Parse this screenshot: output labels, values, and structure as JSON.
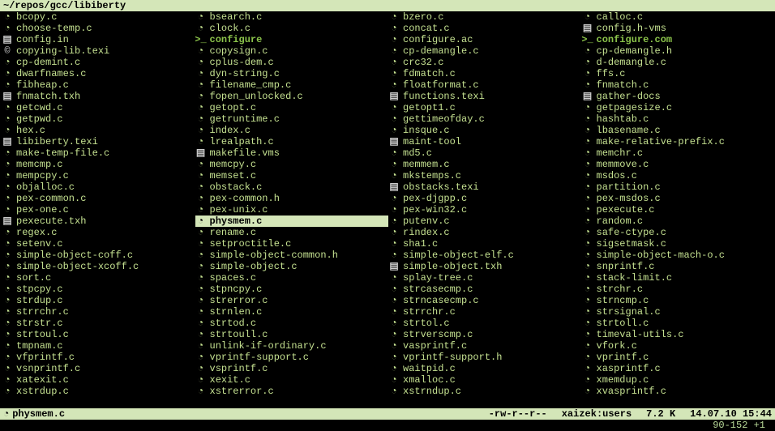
{
  "header": {
    "path": "~/repos/gcc/libiberty"
  },
  "columns": 4,
  "rows": 35,
  "files": [
    {
      "icon": "c",
      "name": "bcopy.c"
    },
    {
      "icon": "c",
      "name": "choose-temp.c"
    },
    {
      "icon": "t",
      "name": "config.in"
    },
    {
      "icon": "o",
      "name": "copying-lib.texi"
    },
    {
      "icon": "c",
      "name": "cp-demint.c"
    },
    {
      "icon": "c",
      "name": "dwarfnames.c"
    },
    {
      "icon": "c",
      "name": "fibheap.c"
    },
    {
      "icon": "t",
      "name": "fnmatch.txh"
    },
    {
      "icon": "c",
      "name": "getcwd.c"
    },
    {
      "icon": "c",
      "name": "getpwd.c"
    },
    {
      "icon": "c",
      "name": "hex.c"
    },
    {
      "icon": "t",
      "name": "libiberty.texi"
    },
    {
      "icon": "c",
      "name": "make-temp-file.c"
    },
    {
      "icon": "c",
      "name": "memcmp.c"
    },
    {
      "icon": "c",
      "name": "mempcpy.c"
    },
    {
      "icon": "c",
      "name": "objalloc.c"
    },
    {
      "icon": "c",
      "name": "pex-common.c"
    },
    {
      "icon": "c",
      "name": "pex-one.c"
    },
    {
      "icon": "t",
      "name": "pexecute.txh"
    },
    {
      "icon": "c",
      "name": "regex.c"
    },
    {
      "icon": "c",
      "name": "setenv.c"
    },
    {
      "icon": "c",
      "name": "simple-object-coff.c"
    },
    {
      "icon": "c",
      "name": "simple-object-xcoff.c"
    },
    {
      "icon": "c",
      "name": "sort.c"
    },
    {
      "icon": "c",
      "name": "stpcpy.c"
    },
    {
      "icon": "c",
      "name": "strdup.c"
    },
    {
      "icon": "c",
      "name": "strrchr.c"
    },
    {
      "icon": "c",
      "name": "strstr.c"
    },
    {
      "icon": "c",
      "name": "strtoul.c"
    },
    {
      "icon": "c",
      "name": "tmpnam.c"
    },
    {
      "icon": "c",
      "name": "vfprintf.c"
    },
    {
      "icon": "c",
      "name": "vsnprintf.c"
    },
    {
      "icon": "c",
      "name": "xatexit.c"
    },
    {
      "icon": "c",
      "name": "xstrdup.c"
    },
    {
      "icon": "",
      "name": ""
    },
    {
      "icon": "c",
      "name": "bsearch.c"
    },
    {
      "icon": "c",
      "name": "clock.c"
    },
    {
      "icon": "x",
      "name": "configure",
      "exec": true
    },
    {
      "icon": "c",
      "name": "copysign.c"
    },
    {
      "icon": "c",
      "name": "cplus-dem.c"
    },
    {
      "icon": "c",
      "name": "dyn-string.c"
    },
    {
      "icon": "c",
      "name": "filename_cmp.c"
    },
    {
      "icon": "c",
      "name": "fopen_unlocked.c"
    },
    {
      "icon": "c",
      "name": "getopt.c"
    },
    {
      "icon": "c",
      "name": "getruntime.c"
    },
    {
      "icon": "c",
      "name": "index.c"
    },
    {
      "icon": "c",
      "name": "lrealpath.c"
    },
    {
      "icon": "t",
      "name": "makefile.vms"
    },
    {
      "icon": "c",
      "name": "memcpy.c"
    },
    {
      "icon": "c",
      "name": "memset.c"
    },
    {
      "icon": "c",
      "name": "obstack.c"
    },
    {
      "icon": "c",
      "name": "pex-common.h"
    },
    {
      "icon": "c",
      "name": "pex-unix.c"
    },
    {
      "icon": "c",
      "name": "physmem.c",
      "selected": true
    },
    {
      "icon": "c",
      "name": "rename.c"
    },
    {
      "icon": "c",
      "name": "setproctitle.c"
    },
    {
      "icon": "c",
      "name": "simple-object-common.h"
    },
    {
      "icon": "c",
      "name": "simple-object.c"
    },
    {
      "icon": "c",
      "name": "spaces.c"
    },
    {
      "icon": "c",
      "name": "stpncpy.c"
    },
    {
      "icon": "c",
      "name": "strerror.c"
    },
    {
      "icon": "c",
      "name": "strnlen.c"
    },
    {
      "icon": "c",
      "name": "strtod.c"
    },
    {
      "icon": "c",
      "name": "strtoull.c"
    },
    {
      "icon": "c",
      "name": "unlink-if-ordinary.c"
    },
    {
      "icon": "c",
      "name": "vprintf-support.c"
    },
    {
      "icon": "c",
      "name": "vsprintf.c"
    },
    {
      "icon": "c",
      "name": "xexit.c"
    },
    {
      "icon": "c",
      "name": "xstrerror.c"
    },
    {
      "icon": "",
      "name": ""
    },
    {
      "icon": "c",
      "name": "bzero.c"
    },
    {
      "icon": "c",
      "name": "concat.c"
    },
    {
      "icon": "c",
      "name": "configure.ac"
    },
    {
      "icon": "c",
      "name": "cp-demangle.c"
    },
    {
      "icon": "c",
      "name": "crc32.c"
    },
    {
      "icon": "c",
      "name": "fdmatch.c"
    },
    {
      "icon": "c",
      "name": "floatformat.c"
    },
    {
      "icon": "t",
      "name": "functions.texi"
    },
    {
      "icon": "c",
      "name": "getopt1.c"
    },
    {
      "icon": "c",
      "name": "gettimeofday.c"
    },
    {
      "icon": "c",
      "name": "insque.c"
    },
    {
      "icon": "t",
      "name": "maint-tool"
    },
    {
      "icon": "c",
      "name": "md5.c"
    },
    {
      "icon": "c",
      "name": "memmem.c"
    },
    {
      "icon": "c",
      "name": "mkstemps.c"
    },
    {
      "icon": "t",
      "name": "obstacks.texi"
    },
    {
      "icon": "c",
      "name": "pex-djgpp.c"
    },
    {
      "icon": "c",
      "name": "pex-win32.c"
    },
    {
      "icon": "c",
      "name": "putenv.c"
    },
    {
      "icon": "c",
      "name": "rindex.c"
    },
    {
      "icon": "c",
      "name": "sha1.c"
    },
    {
      "icon": "c",
      "name": "simple-object-elf.c"
    },
    {
      "icon": "t",
      "name": "simple-object.txh"
    },
    {
      "icon": "c",
      "name": "splay-tree.c"
    },
    {
      "icon": "c",
      "name": "strcasecmp.c"
    },
    {
      "icon": "c",
      "name": "strncasecmp.c"
    },
    {
      "icon": "c",
      "name": "strrchr.c"
    },
    {
      "icon": "c",
      "name": "strtol.c"
    },
    {
      "icon": "c",
      "name": "strverscmp.c"
    },
    {
      "icon": "c",
      "name": "vasprintf.c"
    },
    {
      "icon": "c",
      "name": "vprintf-support.h"
    },
    {
      "icon": "c",
      "name": "waitpid.c"
    },
    {
      "icon": "c",
      "name": "xmalloc.c"
    },
    {
      "icon": "c",
      "name": "xstrndup.c"
    },
    {
      "icon": "",
      "name": ""
    },
    {
      "icon": "c",
      "name": "calloc.c"
    },
    {
      "icon": "t",
      "name": "config.h-vms"
    },
    {
      "icon": "x",
      "name": "configure.com",
      "exec": true
    },
    {
      "icon": "c",
      "name": "cp-demangle.h"
    },
    {
      "icon": "c",
      "name": "d-demangle.c"
    },
    {
      "icon": "c",
      "name": "ffs.c"
    },
    {
      "icon": "c",
      "name": "fnmatch.c"
    },
    {
      "icon": "t",
      "name": "gather-docs"
    },
    {
      "icon": "c",
      "name": "getpagesize.c"
    },
    {
      "icon": "c",
      "name": "hashtab.c"
    },
    {
      "icon": "c",
      "name": "lbasename.c"
    },
    {
      "icon": "c",
      "name": "make-relative-prefix.c"
    },
    {
      "icon": "c",
      "name": "memchr.c"
    },
    {
      "icon": "c",
      "name": "memmove.c"
    },
    {
      "icon": "c",
      "name": "msdos.c"
    },
    {
      "icon": "c",
      "name": "partition.c"
    },
    {
      "icon": "c",
      "name": "pex-msdos.c"
    },
    {
      "icon": "c",
      "name": "pexecute.c"
    },
    {
      "icon": "c",
      "name": "random.c"
    },
    {
      "icon": "c",
      "name": "safe-ctype.c"
    },
    {
      "icon": "c",
      "name": "sigsetmask.c"
    },
    {
      "icon": "c",
      "name": "simple-object-mach-o.c"
    },
    {
      "icon": "c",
      "name": "snprintf.c"
    },
    {
      "icon": "c",
      "name": "stack-limit.c"
    },
    {
      "icon": "c",
      "name": "strchr.c"
    },
    {
      "icon": "c",
      "name": "strncmp.c"
    },
    {
      "icon": "c",
      "name": "strsignal.c"
    },
    {
      "icon": "c",
      "name": "strtoll.c"
    },
    {
      "icon": "c",
      "name": "timeval-utils.c"
    },
    {
      "icon": "c",
      "name": "vfork.c"
    },
    {
      "icon": "c",
      "name": "vprintf.c"
    },
    {
      "icon": "c",
      "name": "xasprintf.c"
    },
    {
      "icon": "c",
      "name": "xmemdup.c"
    },
    {
      "icon": "c",
      "name": "xvasprintf.c"
    },
    {
      "icon": "",
      "name": ""
    }
  ],
  "status": {
    "icon": "c",
    "filename": "physmem.c",
    "perms": "-rw-r--r--",
    "owner": "xaizek:users",
    "size": "7.2 K",
    "date": "14.07.10 15:44"
  },
  "footer": {
    "pos": "90-152 +1"
  },
  "icons": {
    "c": "◔",
    "t": "▤",
    "o": "©",
    "x": ">_"
  }
}
